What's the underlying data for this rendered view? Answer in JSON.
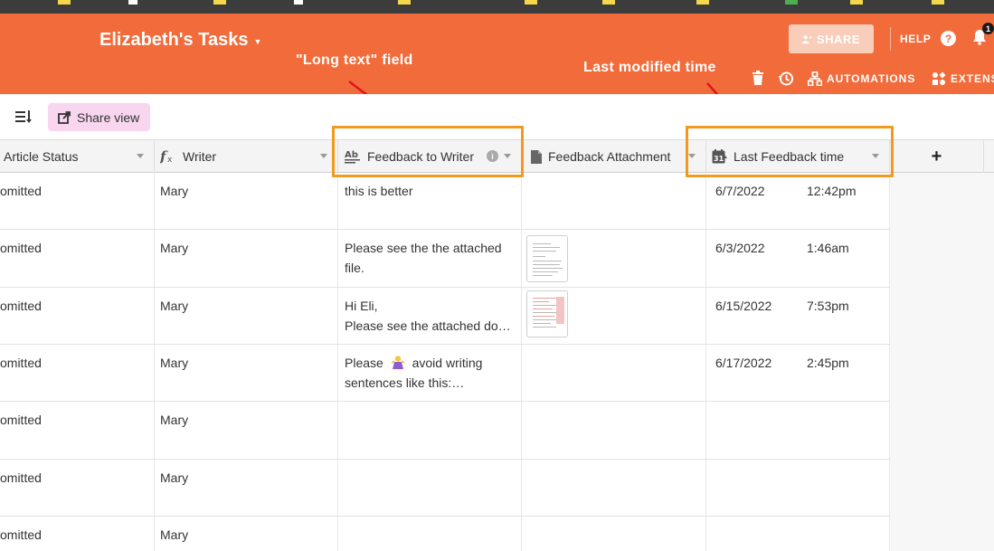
{
  "base": {
    "title": "Elizabeth's Tasks"
  },
  "header": {
    "share_label": "SHARE",
    "help_label": "HELP",
    "help_icon_glyph": "?",
    "notifications_count": "1",
    "automations_label": "AUTOMATIONS",
    "extensions_label": "EXTENS"
  },
  "annotations": {
    "long_text": "\"Long text\" field",
    "last_modified": "Last modified time"
  },
  "toolbar": {
    "share_view_label": "Share view"
  },
  "columns": {
    "status": "Article Status",
    "writer": "Writer",
    "feedback": "Feedback to Writer",
    "attachment": "Feedback Attachment",
    "last_time": "Last Feedback time",
    "add_glyph": "+"
  },
  "rows": [
    {
      "status": "omitted",
      "writer": "Mary",
      "feedback": "this is better",
      "attachment": false,
      "date": "6/7/2022",
      "time": "12:42pm"
    },
    {
      "status": "omitted",
      "writer": "Mary",
      "feedback": "Please see the the attached\nfile.",
      "attachment": true,
      "date": "6/3/2022",
      "time": "1:46am"
    },
    {
      "status": "omitted",
      "writer": "Mary",
      "feedback": "Hi Eli,\nPlease see the attached do…",
      "attachment": true,
      "date": "6/15/2022",
      "time": "7:53pm"
    },
    {
      "status": "omitted",
      "writer": "Mary",
      "feedback_a": "Please",
      "feedback_b": "avoid writing",
      "feedback_c": "sentences like this:…",
      "attachment": false,
      "date": "6/17/2022",
      "time": "2:45pm"
    },
    {
      "status": "omitted",
      "writer": "Mary",
      "feedback": "",
      "attachment": false,
      "date": "",
      "time": ""
    },
    {
      "status": "omitted",
      "writer": "Mary",
      "feedback": "",
      "attachment": false,
      "date": "",
      "time": ""
    },
    {
      "status": "omitted",
      "writer": "Mary",
      "feedback": "",
      "attachment": false,
      "date": "",
      "time": ""
    }
  ],
  "icons": {
    "sort": "row-height-icon",
    "share_view": "share-external-icon",
    "formula": "formula-icon",
    "long_text": "long-text-icon",
    "attachment": "attachment-file-icon",
    "date_modified": "calendar-modified-icon",
    "info": "info-icon",
    "emoji": "person-gesturing-emoji-icon"
  },
  "colors": {
    "topbar": "#f26b3a",
    "highlight": "#f29a1f",
    "arrow": "#e0141e",
    "share_view_bg": "#f8d6f0"
  }
}
